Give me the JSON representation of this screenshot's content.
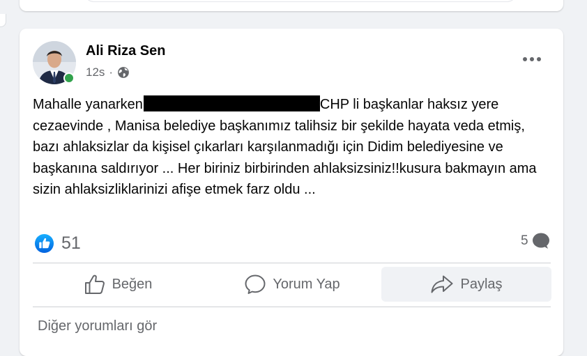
{
  "post": {
    "author": "Ali Riza Sen",
    "time": "12s",
    "text_start": "Mahalle yanarken",
    "text_rest": "CHP li başkanlar haksız yere cezaevinde , Manisa belediye başkanımız talihsiz bir şekilde hayata veda etmiş, bazı ahlaksizlar da kişisel çıkarları karşılanmadığı için Didim belediyesine ve başkanına saldırıyor ... Her biriniz birbirinden ahlaksizsiniz!!kusura bakmayın ama sizin ahlaksizliklarinizi afişe etmek farz oldu ..."
  },
  "stats": {
    "reaction_count": "51",
    "comment_count": "5"
  },
  "actions": {
    "like": "Beğen",
    "comment": "Yorum Yap",
    "share": "Paylaş"
  },
  "comments_link": "Diğer yorumları gör",
  "colors": {
    "online": "#31a24c",
    "like_blue": "#1877f2",
    "muted_text": "#65676b"
  },
  "icons": [
    "more-options-icon",
    "globe-icon",
    "like-reaction-icon",
    "comment-bubble-icon",
    "thumbs-up-icon",
    "speech-bubble-icon",
    "share-arrow-icon"
  ]
}
